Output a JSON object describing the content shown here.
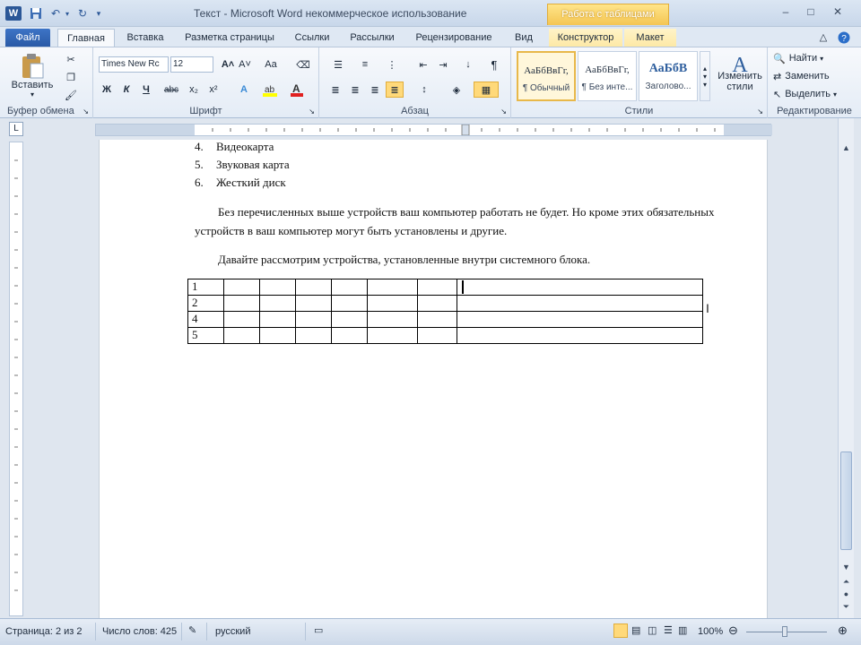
{
  "window": {
    "app_icon": "W",
    "title": "Текст  -  Microsoft Word некоммерческое использование",
    "contextual_group": "Работа с таблицами",
    "controls": [
      "–",
      "□",
      "✕"
    ]
  },
  "quick_access": {
    "save_icon": "save-icon",
    "undo_icon": "undo-icon",
    "redo_icon": "redo-icon",
    "customize_icon": "chevron-down-icon"
  },
  "tabs": [
    {
      "label": "Файл"
    },
    {
      "label": "Главная"
    },
    {
      "label": "Вставка"
    },
    {
      "label": "Разметка страницы"
    },
    {
      "label": "Ссылки"
    },
    {
      "label": "Рассылки"
    },
    {
      "label": "Рецензирование"
    },
    {
      "label": "Вид"
    },
    {
      "label": "Конструктор"
    },
    {
      "label": "Макет"
    }
  ],
  "ribbon": {
    "clipboard": {
      "paste_label": "Вставить",
      "group_label": "Буфер обмена"
    },
    "font": {
      "font_name": "Times New Rc",
      "font_size": "12",
      "bold": "Ж",
      "italic": "К",
      "underline": "Ч",
      "strike": "abc",
      "subscript": "x₂",
      "superscript": "x²",
      "grow": "A˄",
      "shrink": "A˅",
      "case": "Aa",
      "group_label": "Шрифт"
    },
    "paragraph": {
      "pilcrow": "¶",
      "group_label": "Абзац"
    },
    "styles": {
      "items": [
        {
          "sample": "АаБбВвГг,",
          "name": "¶ Обычный"
        },
        {
          "sample": "АаБбВвГг,",
          "name": "¶ Без инте..."
        },
        {
          "sample": "АаБбВ",
          "name": "Заголово..."
        }
      ],
      "change_styles": "Изменить стили",
      "group_label": "Стили"
    },
    "editing": {
      "find": "Найти",
      "replace": "Заменить",
      "select": "Выделить",
      "group_label": "Редактирование"
    }
  },
  "ruler": {
    "corner": "L"
  },
  "document": {
    "list_items": [
      {
        "num": "4.",
        "text": "Видеокарта"
      },
      {
        "num": "5.",
        "text": "Звуковая карта"
      },
      {
        "num": "6.",
        "text": "Жесткий диск"
      }
    ],
    "paragraph1": "Без перечисленных выше устройств ваш компьютер работать не будет. Но кроме этих обязательных устройств в ваш компьютер могут быть установлены и другие.",
    "paragraph2": "Давайте рассмотрим устройства, установленные внутри системного блока.",
    "table_rows": [
      "1",
      "2",
      "4",
      "5"
    ]
  },
  "status": {
    "page": "Страница: 2 из 2",
    "words": "Число слов: 425",
    "language": "русский",
    "zoom": "100%"
  }
}
